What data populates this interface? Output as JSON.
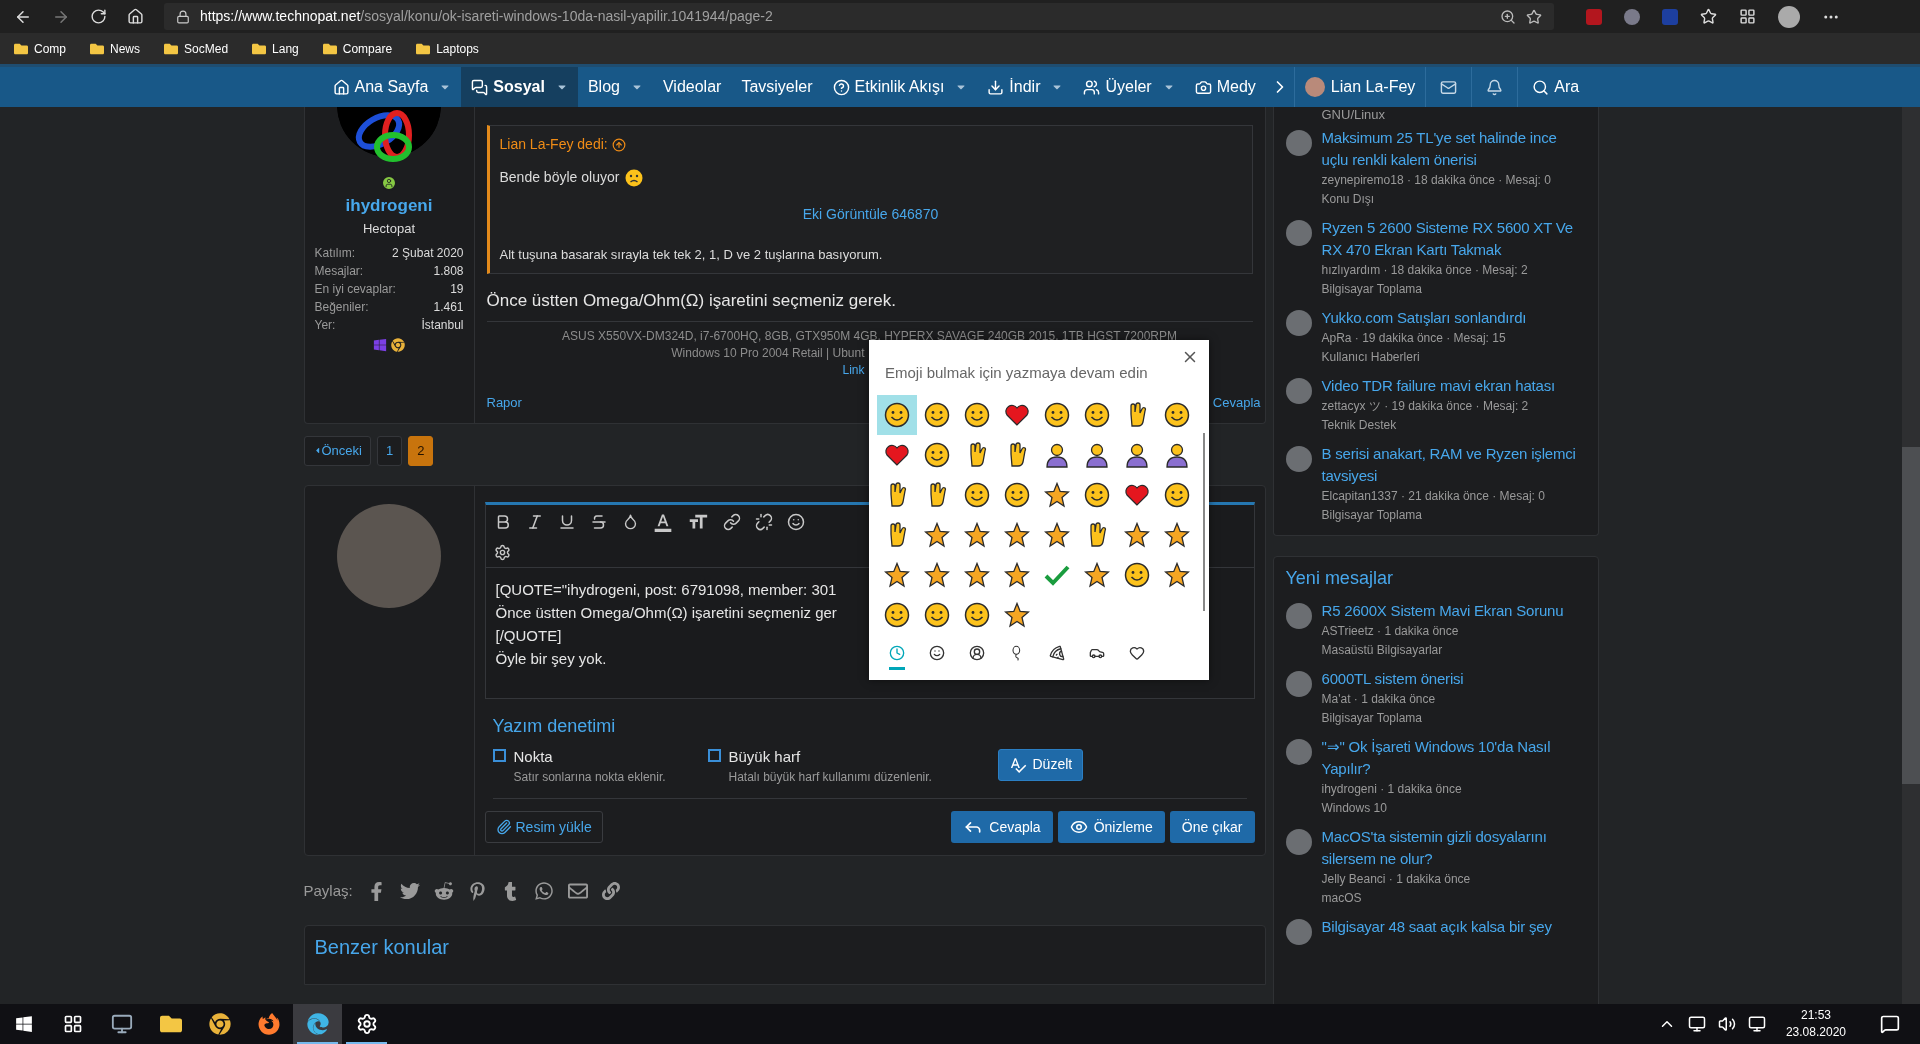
{
  "browser": {
    "url_host": "https://www.technopat.net",
    "url_path": "/sosyal/konu/ok-isareti-windows-10da-nasil-yapilir.1041944/page-2",
    "bookmarks": [
      "Comp",
      "News",
      "SocMed",
      "Lang",
      "Compare",
      "Laptops"
    ]
  },
  "nav": {
    "items": [
      {
        "label": "Ana Sayfa",
        "kind": "home",
        "dropdown": true,
        "selected": false
      },
      {
        "label": "Sosyal",
        "kind": "chat",
        "dropdown": true,
        "selected": true
      },
      {
        "label": "Blog",
        "kind": "plain",
        "dropdown": true,
        "selected": false
      },
      {
        "label": "Videolar",
        "kind": "plain",
        "dropdown": false,
        "selected": false
      },
      {
        "label": "Tavsiyeler",
        "kind": "plain",
        "dropdown": false,
        "selected": false
      },
      {
        "label": "Etkinlik Akışı",
        "kind": "help",
        "dropdown": true,
        "selected": false
      },
      {
        "label": "İndir",
        "kind": "download",
        "dropdown": true,
        "selected": false
      },
      {
        "label": "Üyeler",
        "kind": "users",
        "dropdown": true,
        "selected": false
      },
      {
        "label": "Medy",
        "kind": "camera",
        "dropdown": false,
        "selected": false
      }
    ],
    "user": "Lian La-Fey",
    "search": "Ara"
  },
  "post": {
    "author": "ihydrogeni",
    "title": "Hectopat",
    "stats": [
      {
        "label": "Katılım:",
        "value": "2 Şubat 2020"
      },
      {
        "label": "Mesajlar:",
        "value": "1.808"
      },
      {
        "label": "En iyi cevaplar:",
        "value": "19"
      },
      {
        "label": "Beğeniler:",
        "value": "1.461"
      },
      {
        "label": "Yer:",
        "value": "İstanbul"
      }
    ],
    "quote": {
      "author": "Lian La-Fey dedi:",
      "text": "Bende böyle oluyor",
      "attachment": "Eki Görüntüle 646870",
      "text2": "Alt tuşuna basarak sırayla tek tek 2, 1, D ve 2 tuşlarına basıyorum."
    },
    "body": "Önce üstten Omega/Ohm(Ω) işaretini seçmeniz gerek.",
    "signature": [
      "ASUS X550VX-DM324D, i7-6700HQ, 8GB, GTX950M 4GB, HYPERX SAVAGE 240GB 2015, 1TB HGST 7200RPM",
      "Windows 10 Pro 2004 Retail | Ubunt",
      "Link"
    ],
    "report": "Rapor",
    "reply": "Cevapla"
  },
  "pagination": [
    {
      "label": "Önceki",
      "kind": "prev",
      "selected": false
    },
    {
      "label": "1",
      "kind": "page",
      "selected": false
    },
    {
      "label": "2",
      "kind": "page",
      "selected": true
    }
  ],
  "editor": {
    "lines": [
      "[QUOTE=\"ihydrogeni, post: 6791098, member: 301",
      "Önce üstten Omega/Ohm(Ω) işaretini seçmeniz ger",
      "[/QUOTE]",
      "Öyle bir şey yok."
    ],
    "spellcheck": {
      "title": "Yazım denetimi",
      "options": [
        {
          "label": "Nokta",
          "hint": "Satır sonlarına nokta eklenir.",
          "checked": false
        },
        {
          "label": "Büyük harf",
          "hint": "Hatalı büyük harf kullanımı düzenlenir.",
          "checked": false
        }
      ],
      "button": "Düzelt"
    },
    "buttons": [
      {
        "label": "Resim yükle",
        "kind": "upload"
      },
      {
        "label": "Cevapla",
        "kind": "reply"
      },
      {
        "label": "Önizleme",
        "kind": "preview"
      },
      {
        "label": "Öne çıkar",
        "kind": "feature"
      }
    ]
  },
  "share": {
    "label": "Paylaş:"
  },
  "similar": {
    "title": "Benzer konular"
  },
  "sidebar": {
    "top_category": "GNU/Linux",
    "threads": [
      {
        "title": "Maksimum 25 TL'ye set halinde ince uçlu renkli kalem önerisi",
        "meta": "zeynepiremo18 · 18 dakika önce · Mesaj: 0",
        "category": "Konu Dışı"
      },
      {
        "title": "Ryzen 5 2600 Sisteme RX 5600 XT Ve RX 470 Ekran Kartı Takmak",
        "meta": "hızlıyardım · 18 dakika önce · Mesaj: 2",
        "category": "Bilgisayar Toplama"
      },
      {
        "title": "Yukko.com Satışları sonlandırdı",
        "meta": "ApRa · 19 dakika önce · Mesaj: 15",
        "category": "Kullanıcı Haberleri"
      },
      {
        "title": "Video TDR failure mavi ekran hatası",
        "meta": "zettacyx ツ · 19 dakika önce · Mesaj: 2",
        "category": "Teknik Destek"
      },
      {
        "title": "B serisi anakart, RAM ve Ryzen işlemci tavsiyesi",
        "meta": "Elcapitan1337 · 21 dakika önce · Mesaj: 0",
        "category": "Bilgisayar Toplama"
      }
    ]
  },
  "new_messages": {
    "title": "Yeni mesajlar",
    "threads": [
      {
        "title": "R5 2600X Sistem Mavi Ekran Sorunu",
        "meta": "ASTrieetz · 1 dakika önce",
        "category": "Masaüstü Bilgisayarlar"
      },
      {
        "title": "6000TL sistem önerisi",
        "meta": "Ma'at · 1 dakika önce",
        "category": "Bilgisayar Toplama"
      },
      {
        "title": "\"⇒\" Ok İşareti Windows 10'da Nasıl Yapılır?",
        "meta": "ihydrogeni · 1 dakika önce",
        "category": "Windows 10"
      },
      {
        "title": "MacOS'ta sistemin gizli dosyalarını silersem ne olur?",
        "meta": "Jelly Beanci · 1 dakika önce",
        "category": "macOS"
      },
      {
        "title": "Bilgisayar 48 saat açık kalsa bir şey"
      }
    ]
  },
  "emoji_picker": {
    "placeholder": "Emoji bulmak için yazmaya devam edin",
    "emojis": [
      {
        "kind": "face",
        "selected": true
      },
      {
        "kind": "face",
        "selected": false
      },
      {
        "kind": "face",
        "selected": false
      },
      {
        "kind": "heart",
        "selected": false
      },
      {
        "kind": "face",
        "selected": false
      },
      {
        "kind": "face",
        "selected": false
      },
      {
        "kind": "hand",
        "selected": false
      },
      {
        "kind": "face",
        "selected": false
      },
      {
        "kind": "heart",
        "selected": false
      },
      {
        "kind": "face",
        "selected": false
      },
      {
        "kind": "hand",
        "selected": false
      },
      {
        "kind": "hand",
        "selected": false
      },
      {
        "kind": "person",
        "selected": false
      },
      {
        "kind": "person",
        "selected": false
      },
      {
        "kind": "person",
        "selected": false
      },
      {
        "kind": "person",
        "selected": false
      },
      {
        "kind": "hand",
        "selected": false
      },
      {
        "kind": "hand",
        "selected": false
      },
      {
        "kind": "face",
        "selected": false
      },
      {
        "kind": "face",
        "selected": false
      },
      {
        "kind": "object",
        "selected": false
      },
      {
        "kind": "face",
        "selected": false
      },
      {
        "kind": "heart",
        "selected": false
      },
      {
        "kind": "face",
        "selected": false
      },
      {
        "kind": "hand",
        "selected": false
      },
      {
        "kind": "object",
        "selected": false
      },
      {
        "kind": "object",
        "selected": false
      },
      {
        "kind": "object",
        "selected": false
      },
      {
        "kind": "object",
        "selected": false
      },
      {
        "kind": "hand",
        "selected": false
      },
      {
        "kind": "object",
        "selected": false
      },
      {
        "kind": "object",
        "selected": false
      },
      {
        "kind": "object",
        "selected": false
      },
      {
        "kind": "object",
        "selected": false
      },
      {
        "kind": "object",
        "selected": false
      },
      {
        "kind": "object",
        "selected": false
      },
      {
        "kind": "check",
        "selected": false
      },
      {
        "kind": "object",
        "selected": false
      },
      {
        "kind": "face",
        "selected": false
      },
      {
        "kind": "object",
        "selected": false
      },
      {
        "kind": "face",
        "selected": false
      },
      {
        "kind": "face",
        "selected": false
      },
      {
        "kind": "face",
        "selected": false
      },
      {
        "kind": "object",
        "selected": false
      }
    ],
    "categories": [
      {
        "kind": "recent",
        "selected": true
      },
      {
        "kind": "smileys",
        "selected": false
      },
      {
        "kind": "people",
        "selected": false
      },
      {
        "kind": "celebration",
        "selected": false
      },
      {
        "kind": "food",
        "selected": false
      },
      {
        "kind": "travel",
        "selected": false
      },
      {
        "kind": "symbols",
        "selected": false
      }
    ]
  },
  "taskbar": {
    "apps": [
      {
        "kind": "taskview",
        "open": false,
        "selected": false
      },
      {
        "kind": "app",
        "open": false,
        "selected": false
      },
      {
        "kind": "explorer",
        "open": false,
        "selected": false
      },
      {
        "kind": "chrome",
        "open": false,
        "selected": false
      },
      {
        "kind": "firefox",
        "open": false,
        "selected": false
      },
      {
        "kind": "edge",
        "open": true,
        "selected": true
      },
      {
        "kind": "settings",
        "open": true,
        "selected": false
      }
    ],
    "time": "21:53",
    "date": "23.08.2020"
  }
}
